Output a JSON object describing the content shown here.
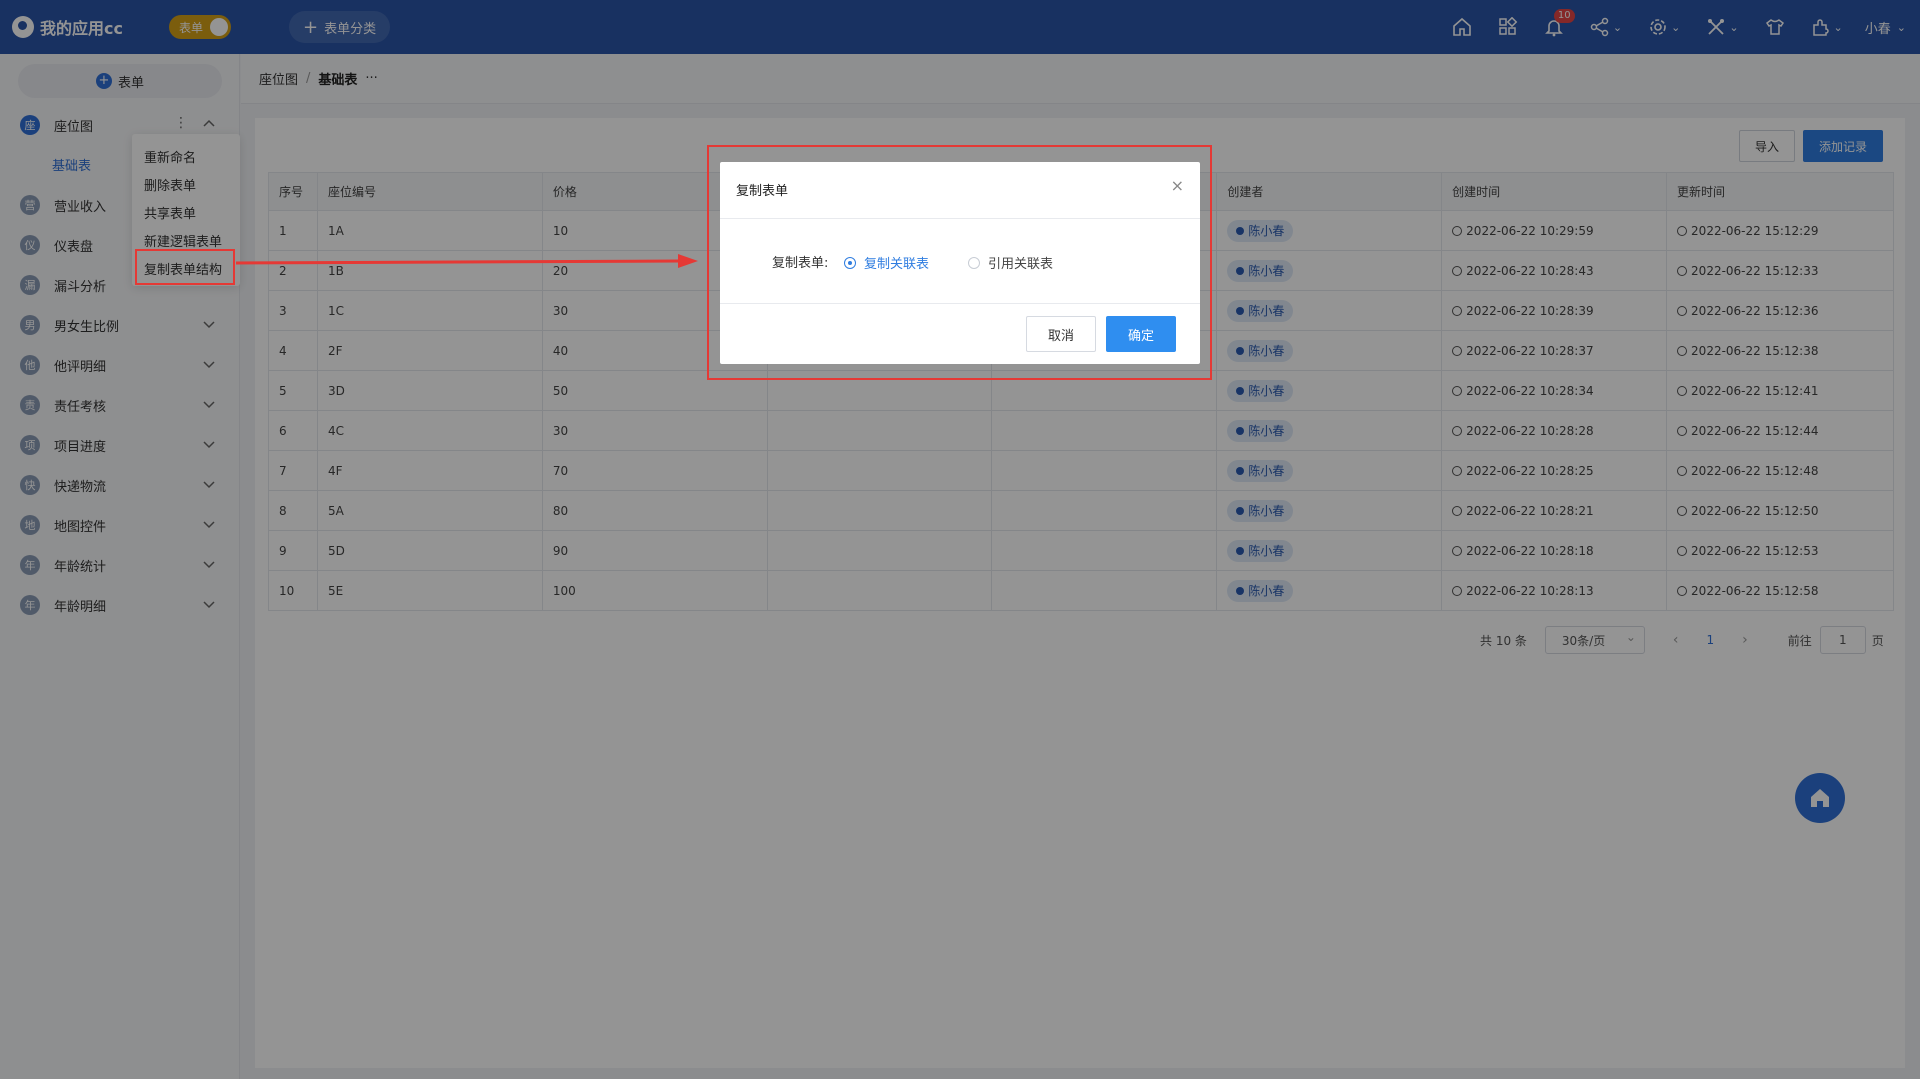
{
  "app": {
    "name": "我的应用cc",
    "toggle_label": "表单",
    "add_category": "表单分类",
    "user": "小春",
    "notification_count": "10"
  },
  "sidebar": {
    "new_form": "表单",
    "items": [
      {
        "avatar": "座",
        "label": "座位图"
      },
      {
        "avatar": "营",
        "label": "营业收入"
      },
      {
        "avatar": "仪",
        "label": "仪表盘"
      },
      {
        "avatar": "漏",
        "label": "漏斗分析"
      },
      {
        "avatar": "男",
        "label": "男女生比例"
      },
      {
        "avatar": "他",
        "label": "他评明细"
      },
      {
        "avatar": "责",
        "label": "责任考核"
      },
      {
        "avatar": "项",
        "label": "项目进度"
      },
      {
        "avatar": "快",
        "label": "快递物流"
      },
      {
        "avatar": "地",
        "label": "地图控件"
      },
      {
        "avatar": "年",
        "label": "年龄统计"
      },
      {
        "avatar": "年",
        "label": "年龄明细"
      }
    ],
    "sub_item": "基础表"
  },
  "context_menu": [
    "重新命名",
    "删除表单",
    "共享表单",
    "新建逻辑表单",
    "复制表单结构"
  ],
  "breadcrumb": {
    "parent": "座位图",
    "sep": "/",
    "current": "基础表",
    "more": "···"
  },
  "toolbar": {
    "import": "导入",
    "add_record": "添加记录"
  },
  "table": {
    "headers": [
      "序号",
      "座位编号",
      "价格",
      "",
      "",
      "创建者",
      "创建时间",
      "更新时间"
    ],
    "rows": [
      [
        "1",
        "1A",
        "10",
        "陈小春",
        "2022-06-22 10:29:59",
        "2022-06-22 15:12:29"
      ],
      [
        "2",
        "1B",
        "20",
        "陈小春",
        "2022-06-22 10:28:43",
        "2022-06-22 15:12:33"
      ],
      [
        "3",
        "1C",
        "30",
        "陈小春",
        "2022-06-22 10:28:39",
        "2022-06-22 15:12:36"
      ],
      [
        "4",
        "2F",
        "40",
        "陈小春",
        "2022-06-22 10:28:37",
        "2022-06-22 15:12:38"
      ],
      [
        "5",
        "3D",
        "50",
        "陈小春",
        "2022-06-22 10:28:34",
        "2022-06-22 15:12:41"
      ],
      [
        "6",
        "4C",
        "30",
        "陈小春",
        "2022-06-22 10:28:28",
        "2022-06-22 15:12:44"
      ],
      [
        "7",
        "4F",
        "70",
        "陈小春",
        "2022-06-22 10:28:25",
        "2022-06-22 15:12:48"
      ],
      [
        "8",
        "5A",
        "80",
        "陈小春",
        "2022-06-22 10:28:21",
        "2022-06-22 15:12:50"
      ],
      [
        "9",
        "5D",
        "90",
        "陈小春",
        "2022-06-22 10:28:18",
        "2022-06-22 15:12:53"
      ],
      [
        "10",
        "5E",
        "100",
        "陈小春",
        "2022-06-22 10:28:13",
        "2022-06-22 15:12:58"
      ]
    ]
  },
  "pager": {
    "total": "共 10 条",
    "size": "30条/页",
    "prev": "‹",
    "current": "1",
    "next": "›",
    "goto": "前往",
    "page_input": "1",
    "unit": "页"
  },
  "dialog": {
    "title": "复制表单",
    "close": "×",
    "field_label": "复制表单:",
    "option_copy": "复制关联表",
    "option_ref": "引用关联表",
    "cancel": "取消",
    "ok": "确定"
  },
  "colors": {
    "topbar": "#2a55a8",
    "primary": "#2f7de0",
    "highlight": "#e53935"
  }
}
